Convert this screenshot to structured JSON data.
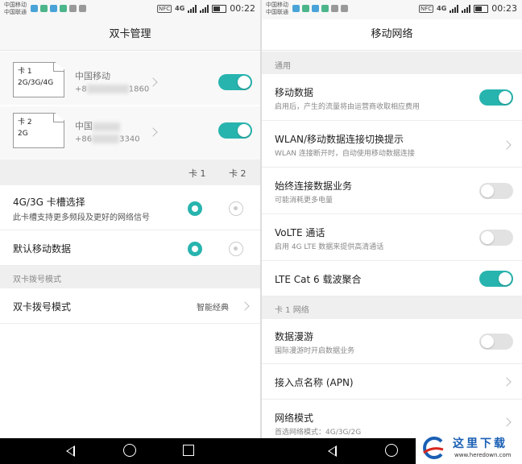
{
  "left": {
    "status": {
      "carrier1": "中国移动",
      "carrier2": "中国联通",
      "network": "4G",
      "time": "00:22"
    },
    "title": "双卡管理",
    "sims": [
      {
        "card_label": "卡 1",
        "card_type": "2G/3G/4G",
        "operator": "中国移动",
        "number_prefix": "+8",
        "number_suffix": "1860",
        "enabled": true
      },
      {
        "card_label": "卡 2",
        "card_type": "2G",
        "operator": "中国",
        "number_prefix": "+86",
        "number_suffix": "3340",
        "enabled": true
      }
    ],
    "columns": {
      "card1": "卡 1",
      "card2": "卡 2"
    },
    "rows": [
      {
        "title": "4G/3G 卡槽选择",
        "subtitle": "此卡槽支持更多频段及更好的网络信号",
        "selected": 1
      },
      {
        "title": "默认移动数据",
        "subtitle": "",
        "selected": 1
      }
    ],
    "section_dual_dial": "双卡拨号模式",
    "dial_row": {
      "title": "双卡拨号模式",
      "value": "智能经典"
    }
  },
  "right": {
    "status": {
      "carrier1": "中国移动",
      "carrier2": "中国联通",
      "network": "4G",
      "time": "00:23"
    },
    "title": "移动网络",
    "section_general": "通用",
    "general_rows": [
      {
        "title": "移动数据",
        "subtitle": "启用后，产生的流量将由运营商收取相应费用",
        "control": "toggle",
        "on": true
      },
      {
        "title": "WLAN/移动数据连接切换提示",
        "subtitle": "WLAN 连接断开时，自动使用移动数据连接",
        "control": "chevron",
        "on": false
      },
      {
        "title": "始终连接数据业务",
        "subtitle": "可能消耗更多电量",
        "control": "toggle",
        "on": false
      },
      {
        "title": "VoLTE 通话",
        "subtitle": "启用 4G LTE 数据来提供高清通话",
        "control": "toggle",
        "on": false
      },
      {
        "title": "LTE Cat 6 载波聚合",
        "subtitle": "",
        "control": "toggle",
        "on": true
      }
    ],
    "section_card1": "卡 1 网络",
    "card1_rows": [
      {
        "title": "数据漫游",
        "subtitle": "国际漫游时开启数据业务",
        "control": "toggle",
        "on": false
      },
      {
        "title": "接入点名称 (APN)",
        "subtitle": "",
        "control": "chevron",
        "on": false
      },
      {
        "title": "网络模式",
        "subtitle": "首选网络模式：4G/3G/2G",
        "control": "chevron",
        "on": false
      }
    ]
  },
  "watermark": {
    "text": "这里下载",
    "url": "www.heredown.com"
  },
  "colors": {
    "accent": "#28b4ae",
    "toggle_off": "#e2e2e2",
    "section_bg": "#efefef"
  },
  "icons": {
    "back": "back-triangle-icon",
    "home": "home-circle-icon",
    "recent": "recent-square-icon"
  }
}
